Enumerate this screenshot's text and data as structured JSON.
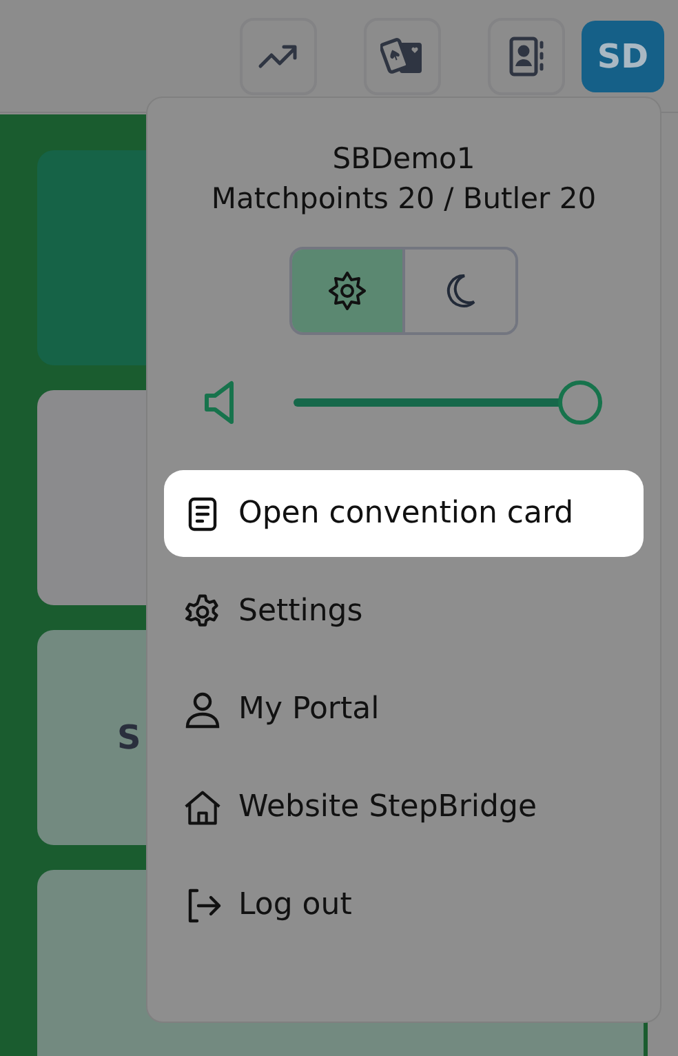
{
  "header": {
    "buttons": [
      {
        "kind": "trend"
      },
      {
        "kind": "cards"
      },
      {
        "kind": "contacts"
      }
    ],
    "avatar": "SD"
  },
  "background_cards": [
    {
      "color": "#166347"
    },
    {
      "color": "#8b8b8d"
    },
    {
      "color": "#738a80",
      "label": "S"
    },
    {
      "color": "#738a80"
    }
  ],
  "menu": {
    "title": "SBDemo1",
    "subtitle": "Matchpoints 20 / Butler 20",
    "theme": [
      {
        "kind": "light",
        "selected": true
      },
      {
        "kind": "dark",
        "selected": false
      }
    ],
    "volume": {
      "level": 1
    },
    "items": [
      {
        "kind": "card",
        "label": "Open convention card",
        "highlighted": true
      },
      {
        "kind": "settings",
        "label": "Settings",
        "highlighted": false
      },
      {
        "kind": "person",
        "label": "My Portal",
        "highlighted": false
      },
      {
        "kind": "home",
        "label": "Website StepBridge",
        "highlighted": false
      },
      {
        "kind": "logout",
        "label": "Log out",
        "highlighted": false
      }
    ]
  }
}
